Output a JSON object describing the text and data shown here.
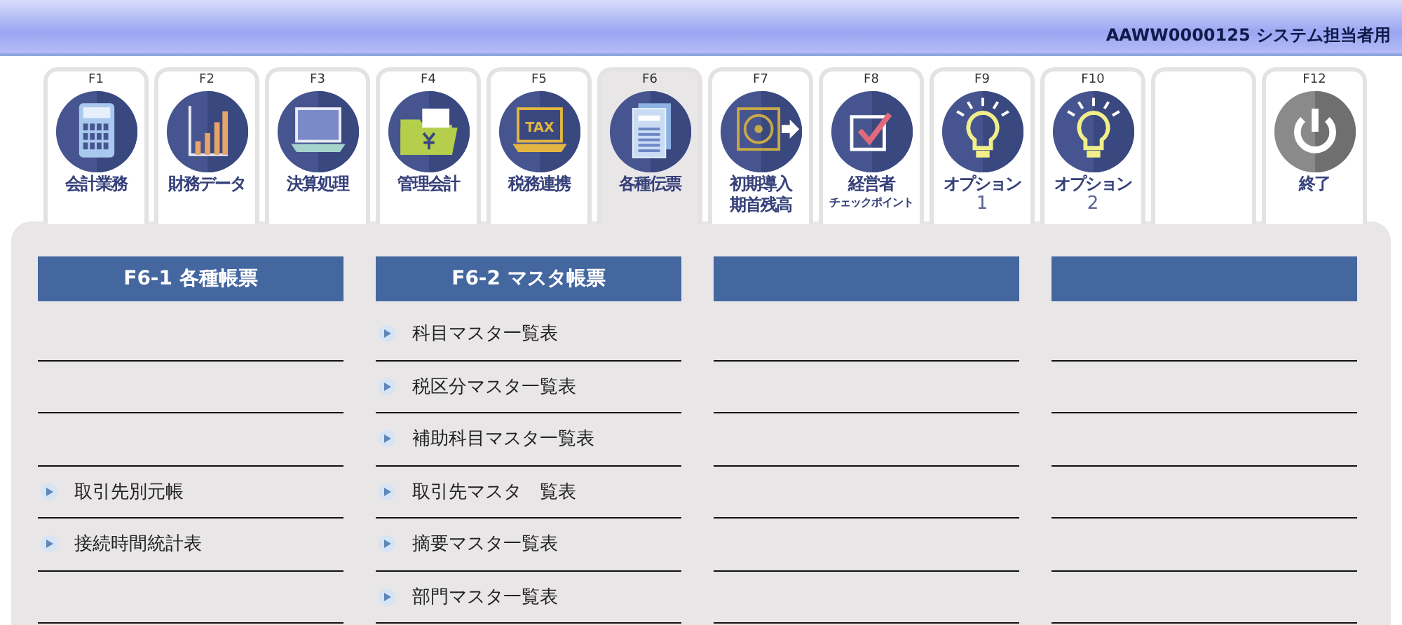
{
  "header": {
    "user": "AAWW0000125 システム担当者用"
  },
  "tabs": [
    {
      "key": "F1",
      "label": "会計業務",
      "selected": false
    },
    {
      "key": "F2",
      "label": "財務データ",
      "selected": false
    },
    {
      "key": "F3",
      "label": "決算処理",
      "selected": false
    },
    {
      "key": "F4",
      "label": "管理会計",
      "selected": false
    },
    {
      "key": "F5",
      "label": "税務連携",
      "icon_text": "TAX",
      "selected": false
    },
    {
      "key": "F6",
      "label": "各種伝票",
      "selected": true
    },
    {
      "key": "F7",
      "label": "初期導入",
      "sublabel": "期首残高",
      "kind": "two_line",
      "selected": false
    },
    {
      "key": "F8",
      "label": "経営者",
      "sublabel": "チェックポイント",
      "kind": "small_sub",
      "selected": false
    },
    {
      "key": "F9",
      "label": "オプション",
      "sublabel": "1",
      "kind": "numbered",
      "selected": false
    },
    {
      "key": "F10",
      "label": "オプション",
      "sublabel": "2",
      "kind": "numbered",
      "selected": false
    },
    {
      "selected": false
    },
    {
      "key": "F12",
      "label": "終了",
      "selected": false
    }
  ],
  "columns": [
    {
      "title": "F6-1 各種帳票",
      "rows": [
        {},
        {},
        {},
        {
          "label": "取引先別元帳"
        },
        {
          "label": "接続時間統計表"
        },
        {}
      ]
    },
    {
      "title": "F6-2 マスタ帳票",
      "rows": [
        {
          "label": "科目マスタ一覧表"
        },
        {
          "label": "税区分マスタ一覧表"
        },
        {
          "label": "補助科目マスタ一覧表"
        },
        {
          "label": "取引先マスタ　覧表"
        },
        {
          "label": "摘要マスタ一覧表"
        },
        {
          "label": "部門マスタ一覧表"
        }
      ]
    },
    {
      "rows": [
        {},
        {},
        {},
        {},
        {},
        {}
      ]
    },
    {
      "rows": [
        {},
        {},
        {},
        {},
        {},
        {}
      ]
    }
  ]
}
